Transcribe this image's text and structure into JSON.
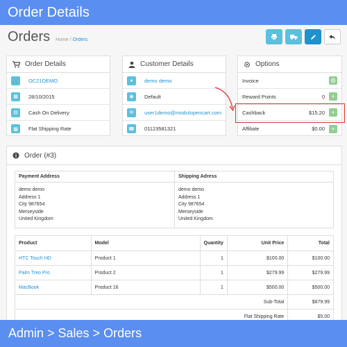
{
  "banner": {
    "top": "Order Details",
    "bottom": "Admin > Sales > Orders"
  },
  "header": {
    "title": "Orders",
    "breadcrumb": [
      {
        "label": "Home"
      },
      {
        "label": "Orders"
      }
    ],
    "toolbar": {
      "print_icon": "print-icon",
      "truck_icon": "truck-icon",
      "edit_icon": "pencil-icon",
      "back_icon": "reply-icon"
    }
  },
  "order_details": {
    "title": "Order Details",
    "rows": [
      {
        "icon": "shopping-cart-icon",
        "value": "OC21DEMO"
      },
      {
        "icon": "calendar-icon",
        "value": "28/10/2015"
      },
      {
        "icon": "credit-card-icon",
        "value": "Cash On Delivery"
      },
      {
        "icon": "truck-icon",
        "value": "Flat Shipping Rate"
      }
    ]
  },
  "customer_details": {
    "title": "Customer Details",
    "rows": [
      {
        "icon": "user-icon",
        "value": "demo demo"
      },
      {
        "icon": "group-icon",
        "value": "Default"
      },
      {
        "icon": "envelope-icon",
        "value": "user1demo@modulopencart.com"
      },
      {
        "icon": "phone-icon",
        "value": "01123581321"
      }
    ]
  },
  "options": {
    "title": "Options",
    "rows": [
      {
        "label": "Invoice",
        "value": ""
      },
      {
        "label": "Reward Points",
        "value": "0"
      },
      {
        "label": "Cashback",
        "value": "$15.20"
      },
      {
        "label": "Affiliate",
        "value": "$0.00"
      }
    ]
  },
  "order": {
    "title": "Order (#3)",
    "payment_header": "Payment Address",
    "shipping_header": "Shipping Adress",
    "payment_address": [
      "demo demo",
      "Address 1",
      "City 987654",
      "Merseyside",
      "United Kingdom"
    ],
    "shipping_address": [
      "demo demo",
      "Address 1",
      "City 987654",
      "Merseyside",
      "United Kingdom"
    ],
    "columns": [
      "Product",
      "Model",
      "Quantity",
      "Unit Price",
      "Total"
    ],
    "products": [
      {
        "product": "HTC Touch HD",
        "model": "Product 1",
        "quantity": "1",
        "price": "$100.00",
        "total": "$100.00"
      },
      {
        "product": "Palm Treo Pro",
        "model": "Product 2",
        "quantity": "1",
        "price": "$279.99",
        "total": "$279.99"
      },
      {
        "product": "MacBook",
        "model": "Product 16",
        "quantity": "1",
        "price": "$500.00",
        "total": "$500.00"
      }
    ],
    "totals": [
      {
        "label": "Sub-Total",
        "value": "$879.99"
      },
      {
        "label": "Flat Shipping Rate",
        "value": "$5.00"
      }
    ]
  },
  "colors": {
    "banner": "#5a8ef0",
    "info": "#5bc0de",
    "primary": "#1e91cf",
    "success": "#8fcf8f",
    "highlight": "#dd3333"
  }
}
